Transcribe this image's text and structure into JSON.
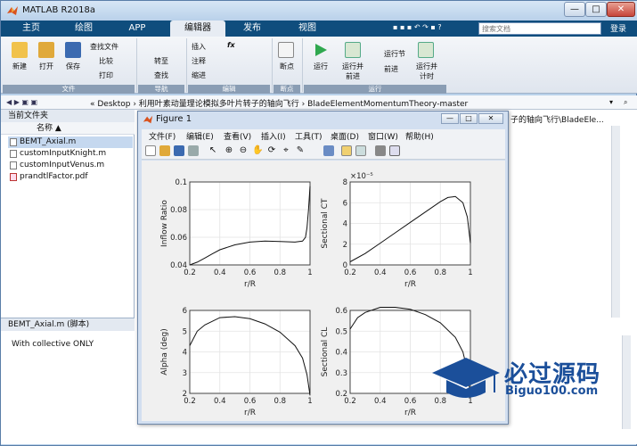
{
  "app": {
    "title": "MATLAB R2018a"
  },
  "window_controls": {
    "minimize": "—",
    "maximize": "□",
    "close": "✕"
  },
  "tabs": [
    {
      "label": "主页"
    },
    {
      "label": "绘图"
    },
    {
      "label": "APP"
    },
    {
      "label": "编辑器"
    },
    {
      "label": "发布"
    },
    {
      "label": "视图"
    }
  ],
  "search": {
    "placeholder": "搜索文档"
  },
  "login": "登录",
  "ribbon": {
    "new": "新建",
    "open": "打开",
    "save": "保存",
    "find_files": "查找文件",
    "compare": "比较",
    "print": "打印",
    "insert": "插入",
    "fx": "fx",
    "comment": "注释",
    "indent": "缩进",
    "goto": "转至",
    "find": "查找",
    "breakpoint": "断点",
    "run": "运行",
    "run_advance": "运行并\n前进",
    "run_section": "运行节",
    "advance": "前进",
    "run_time": "运行并\n计时",
    "groups": {
      "file": "文件",
      "nav": "导航",
      "edit": "编辑",
      "breakpoints": "断点",
      "run": "运行"
    }
  },
  "address": {
    "path": "« Desktop › 利用叶素动量理论模拟多叶片转子的轴向飞行 › BladeElementMomentumTheory-master"
  },
  "current_folder": {
    "header": "当前文件夹",
    "col_name": "名称 ▲",
    "files": [
      {
        "name": "BEMT_Axial.m",
        "type": "m"
      },
      {
        "name": "customInputKnight.m",
        "type": "m"
      },
      {
        "name": "customInputVenus.m",
        "type": "m"
      },
      {
        "name": "prandtlFactor.pdf",
        "type": "pdf"
      }
    ]
  },
  "details": {
    "header": "BEMT_Axial.m (脚本)",
    "text": "With collective ONLY"
  },
  "editor": {
    "right_text": "子的轴向飞行\\BladeEle..."
  },
  "figure": {
    "title": "Figure 1",
    "menus": [
      "文件(F)",
      "编辑(E)",
      "查看(V)",
      "插入(I)",
      "工具(T)",
      "桌面(D)",
      "窗口(W)",
      "帮助(H)"
    ]
  },
  "chart_data": [
    {
      "type": "line",
      "xlabel": "r/R",
      "ylabel": "Inflow Ratio",
      "xlim": [
        0.2,
        1
      ],
      "ylim": [
        0.04,
        0.1
      ],
      "xticks": [
        "0.2",
        "0.4",
        "0.6",
        "0.8",
        "1"
      ],
      "yticks": [
        "0.04",
        "0.06",
        "0.08",
        "0.1"
      ],
      "x": [
        0.2,
        0.25,
        0.3,
        0.35,
        0.4,
        0.5,
        0.6,
        0.7,
        0.8,
        0.9,
        0.95,
        0.97,
        0.98,
        0.99,
        1.0
      ],
      "y": [
        0.04,
        0.042,
        0.045,
        0.048,
        0.051,
        0.0545,
        0.0565,
        0.0572,
        0.057,
        0.0565,
        0.0572,
        0.06,
        0.067,
        0.08,
        0.097
      ],
      "grid": true
    },
    {
      "type": "line",
      "xlabel": "r/R",
      "ylabel": "Sectional CT",
      "multiplier": "×10⁻⁵",
      "xlim": [
        0.2,
        1
      ],
      "ylim": [
        0,
        8
      ],
      "xticks": [
        "0.2",
        "0.4",
        "0.6",
        "0.8",
        "1"
      ],
      "yticks": [
        "0",
        "2",
        "4",
        "6",
        "8"
      ],
      "x": [
        0.2,
        0.3,
        0.4,
        0.5,
        0.6,
        0.7,
        0.8,
        0.85,
        0.9,
        0.95,
        0.98,
        1.0
      ],
      "y": [
        0.3,
        1.1,
        2.1,
        3.1,
        4.1,
        5.1,
        6.1,
        6.5,
        6.6,
        6.0,
        4.6,
        2.1
      ],
      "grid": true
    },
    {
      "type": "line",
      "xlabel": "r/R",
      "ylabel": "Alpha (deg)",
      "xlim": [
        0.2,
        1
      ],
      "ylim": [
        2,
        6
      ],
      "xticks": [
        "0.2",
        "0.4",
        "0.6",
        "0.8",
        "1"
      ],
      "yticks": [
        "2",
        "3",
        "4",
        "5",
        "6"
      ],
      "x": [
        0.2,
        0.25,
        0.3,
        0.4,
        0.5,
        0.6,
        0.7,
        0.8,
        0.9,
        0.95,
        0.98,
        1.0
      ],
      "y": [
        4.3,
        5.0,
        5.3,
        5.65,
        5.7,
        5.6,
        5.35,
        4.95,
        4.3,
        3.7,
        2.9,
        1.9
      ],
      "grid": true
    },
    {
      "type": "line",
      "xlabel": "r/R",
      "ylabel": "Sectional CL",
      "xlim": [
        0.2,
        1
      ],
      "ylim": [
        0.2,
        0.6
      ],
      "xticks": [
        "0.2",
        "0.4",
        "0.6",
        "0.8",
        "1"
      ],
      "yticks": [
        "0.2",
        "0.3",
        "0.4",
        "0.5",
        "0.6"
      ],
      "x": [
        0.2,
        0.25,
        0.3,
        0.4,
        0.5,
        0.6,
        0.7,
        0.8,
        0.9,
        0.95,
        0.98,
        1.0
      ],
      "y": [
        0.51,
        0.565,
        0.59,
        0.615,
        0.615,
        0.605,
        0.58,
        0.54,
        0.47,
        0.4,
        0.31,
        0.19
      ],
      "grid": true
    }
  ],
  "watermark": {
    "name": "必过源码",
    "url": "Biguo100.com"
  }
}
